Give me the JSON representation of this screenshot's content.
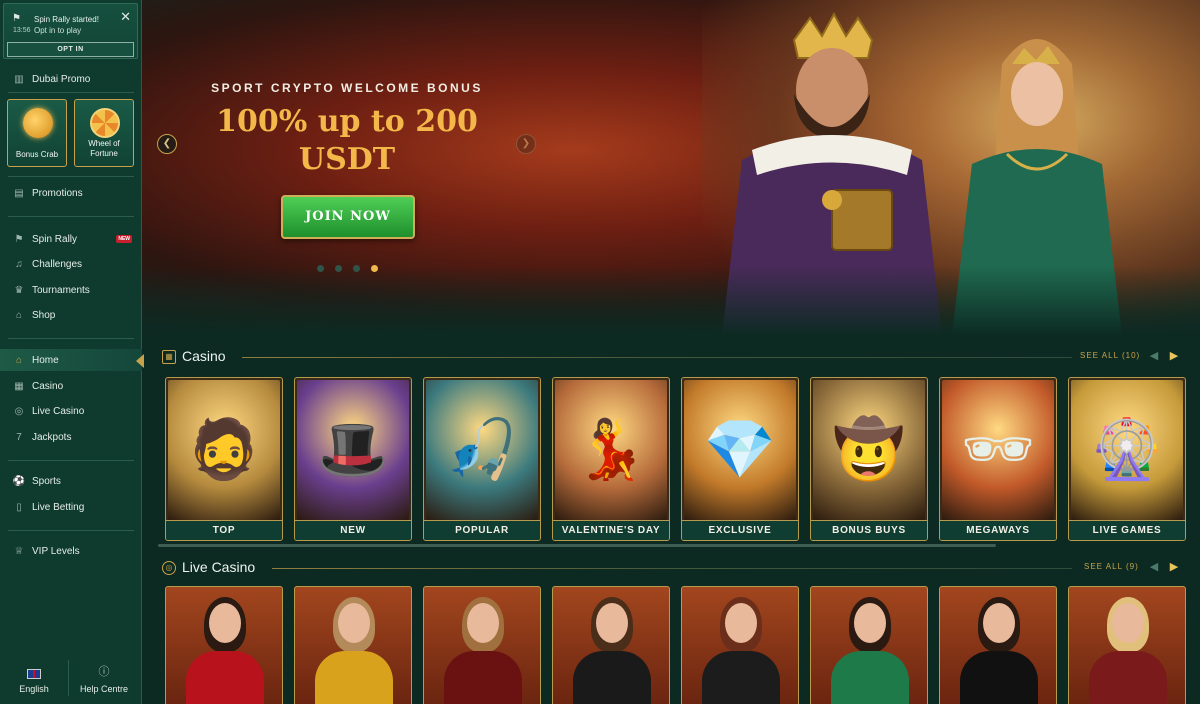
{
  "notification": {
    "title": "Spin Rally started!",
    "time": "13:56",
    "subtitle": "Opt in to play",
    "button": "OPT IN"
  },
  "sidebar": {
    "dubai_promo": "Dubai Promo",
    "tiles": [
      {
        "label": "Bonus Crab",
        "icon": "crab-claw-icon"
      },
      {
        "label": "Wheel of Fortune",
        "icon": "wheel-icon"
      }
    ],
    "promotions": "Promotions",
    "group1": [
      {
        "label": "Spin Rally",
        "icon": "flag-icon",
        "badge": "NEW"
      },
      {
        "label": "Challenges",
        "icon": "bell-icon"
      },
      {
        "label": "Tournaments",
        "icon": "trophy-icon"
      },
      {
        "label": "Shop",
        "icon": "shop-icon"
      }
    ],
    "group2": [
      {
        "label": "Home",
        "icon": "home-icon",
        "active": true
      },
      {
        "label": "Casino",
        "icon": "casino-icon"
      },
      {
        "label": "Live Casino",
        "icon": "live-casino-icon"
      },
      {
        "label": "Jackpots",
        "icon": "jackpot-icon"
      }
    ],
    "group3": [
      {
        "label": "Sports",
        "icon": "ball-icon"
      },
      {
        "label": "Live Betting",
        "icon": "live-betting-icon"
      }
    ],
    "vip": "VIP Levels",
    "footer": {
      "language": "English",
      "help": "Help Centre"
    }
  },
  "hero": {
    "kicker": "SPORT CRYPTO WELCOME BONUS",
    "headline_line1": "100% up to 200",
    "headline_line2": "USDT",
    "cta": "JOIN NOW",
    "slides": 4,
    "active_slide": 4
  },
  "casino_section": {
    "title": "Casino",
    "see_all": "SEE ALL (10)",
    "cards": [
      {
        "label": "TOP",
        "glyph": "🧔",
        "bg": "#b58a3e"
      },
      {
        "label": "NEW",
        "glyph": "🎩",
        "bg": "#6a3f8e"
      },
      {
        "label": "POPULAR",
        "glyph": "🎣",
        "bg": "#3c7a7e"
      },
      {
        "label": "VALENTINE'S DAY",
        "glyph": "💃",
        "bg": "#b66b3b"
      },
      {
        "label": "EXCLUSIVE",
        "glyph": "💎",
        "bg": "#c27a2a"
      },
      {
        "label": "BONUS BUYS",
        "glyph": "🤠",
        "bg": "#8a6a3a"
      },
      {
        "label": "MEGAWAYS",
        "glyph": "🕶",
        "bg": "#c25a2a"
      },
      {
        "label": "LIVE GAMES",
        "glyph": "🎡",
        "bg": "#c59a3a"
      }
    ]
  },
  "live_section": {
    "title": "Live Casino",
    "see_all": "SEE ALL (9)",
    "dealers": [
      {
        "hair": "#2a1a12",
        "outfit": "#b8121c"
      },
      {
        "hair": "#b38a5a",
        "outfit": "#d8a21c"
      },
      {
        "hair": "#a0703e",
        "outfit": "#6a1212"
      },
      {
        "hair": "#4a2e1a",
        "outfit": "#1a1a1a"
      },
      {
        "hair": "#6a2e1a",
        "outfit": "#1c1c1c"
      },
      {
        "hair": "#2a1a12",
        "outfit": "#1f7a4a"
      },
      {
        "hair": "#2a1a12",
        "outfit": "#111111"
      },
      {
        "hair": "#e0c07a",
        "outfit": "#7a1a1a"
      }
    ]
  },
  "colors": {
    "gold": "#c8a24a",
    "sidebar_bg": "#0f3a2e",
    "page_bg": "#0c2a22",
    "cta_green": "#2aa83a",
    "headline": "#f4b84a"
  }
}
